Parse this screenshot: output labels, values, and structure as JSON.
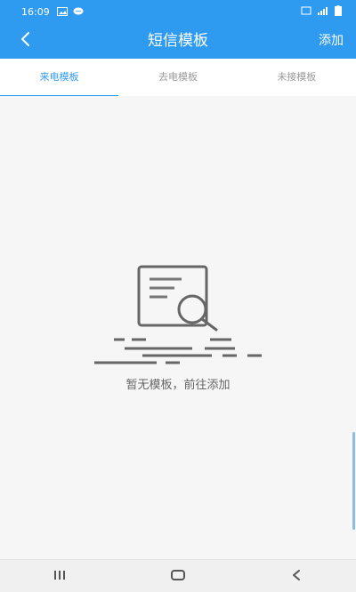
{
  "status_bar": {
    "time": "16:09",
    "icons": [
      "image-icon",
      "chat-bubble-icon",
      "sim-icon",
      "signal-icon",
      "battery-icon"
    ]
  },
  "header": {
    "title": "短信模板",
    "add_label": "添加",
    "back_icon": "chevron-left-icon"
  },
  "tabs": [
    {
      "label": "来电模板",
      "active": true
    },
    {
      "label": "去电模板",
      "active": false
    },
    {
      "label": "未接模板",
      "active": false
    }
  ],
  "empty_state": {
    "message": "暂无模板，前往添加",
    "icon": "document-search-icon"
  },
  "nav_bar": {
    "icons": [
      "recent-apps-icon",
      "home-icon",
      "back-icon"
    ]
  },
  "colors": {
    "primary": "#2f9bf0",
    "background": "#f6f6f6",
    "text_muted": "#9a9a9a"
  }
}
